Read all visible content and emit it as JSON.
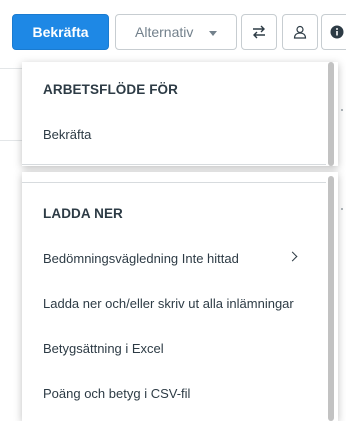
{
  "toolbar": {
    "confirm_label": "Bekräfta",
    "options_label": "Alternativ",
    "swap_icon": "swap-arrows-icon",
    "user_icon": "user-icon",
    "info_icon": "info-icon"
  },
  "dropdown": {
    "workflow": {
      "heading": "ARBETSFLÖDE FÖR",
      "items": [
        "Bekräfta"
      ]
    },
    "download": {
      "heading": "LADDA NER",
      "items": [
        "Bedömningsvägledning Inte hittad",
        "Ladda ner och/eller skriv ut alla inlämningar",
        "Betygsättning i Excel",
        "Poäng och betyg i CSV-fil"
      ]
    }
  },
  "colors": {
    "primary": "#1e88e5",
    "text": "#2d3b45",
    "muted": "#73818c",
    "border": "#c7cdd1"
  }
}
